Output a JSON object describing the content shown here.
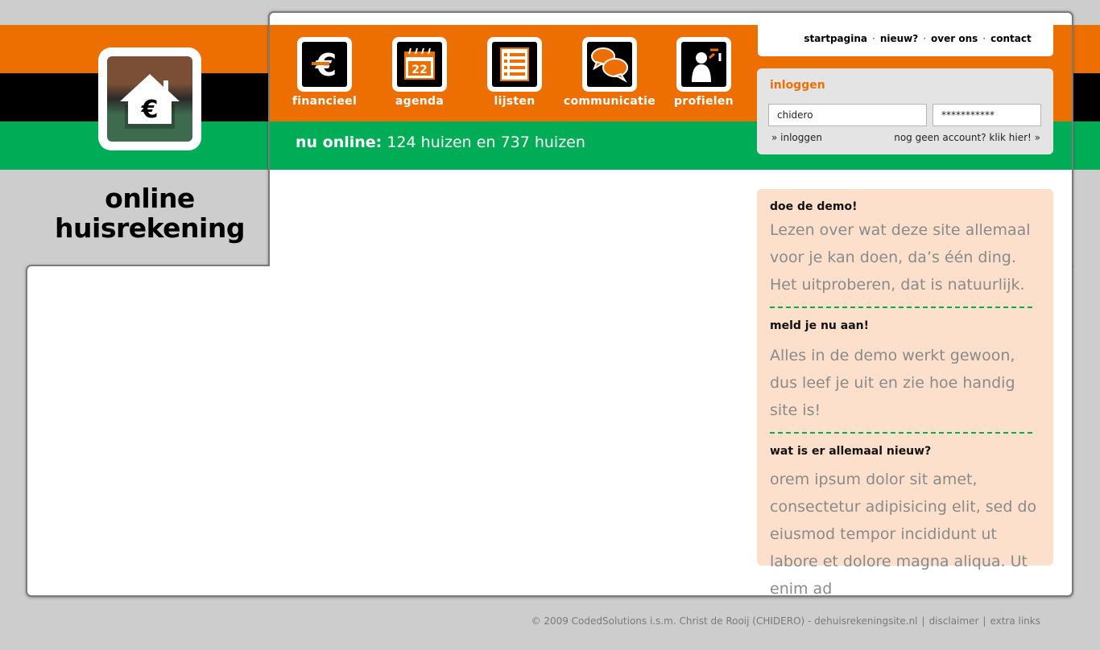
{
  "site": {
    "title_line1": "online",
    "title_line2": "huisrekening"
  },
  "nav": [
    {
      "label": "financieel",
      "icon": "euro-icon"
    },
    {
      "label": "agenda",
      "icon": "calendar-icon",
      "day": "22"
    },
    {
      "label": "lijsten",
      "icon": "list-icon"
    },
    {
      "label": "communicatie",
      "icon": "chat-bubbles-icon"
    },
    {
      "label": "profielen",
      "icon": "profile-icon"
    }
  ],
  "online": {
    "label": "nu online:",
    "text": "124 huizen en 737 huizen"
  },
  "toplinks": [
    "startpagina",
    "nieuw?",
    "over ons",
    "contact"
  ],
  "login": {
    "title": "inloggen",
    "username": "chidero",
    "password": "***********",
    "login_link": "» inloggen",
    "register_link": "nog geen account? klik hier! »"
  },
  "demo": {
    "h1": "doe de demo!",
    "p1": "Lezen over wat deze site allemaal voor je kan doen, da’s één ding. Het uitproberen, dat is natuurlijk.",
    "h2": "meld je nu aan!",
    "p2": "Alles in de demo werkt gewoon, dus leef je uit en zie hoe handig site is!",
    "h3": "wat is er allemaal nieuw?",
    "p3": "orem ipsum dolor sit amet, consectetur adipisicing elit, sed do eiusmod tempor incididunt ut labore et dolore magna aliqua. Ut enim ad"
  },
  "footer": {
    "copyright": "© 2009 CodedSolutions i.s.m. Christ de Rooij (CHIDERO) - dehuisrekeningsite.nl",
    "disclaimer": "disclaimer",
    "extra": "extra links"
  },
  "colors": {
    "orange": "#ed6f02",
    "green": "#00ad56",
    "black": "#000000",
    "peach": "#fde0cb"
  }
}
